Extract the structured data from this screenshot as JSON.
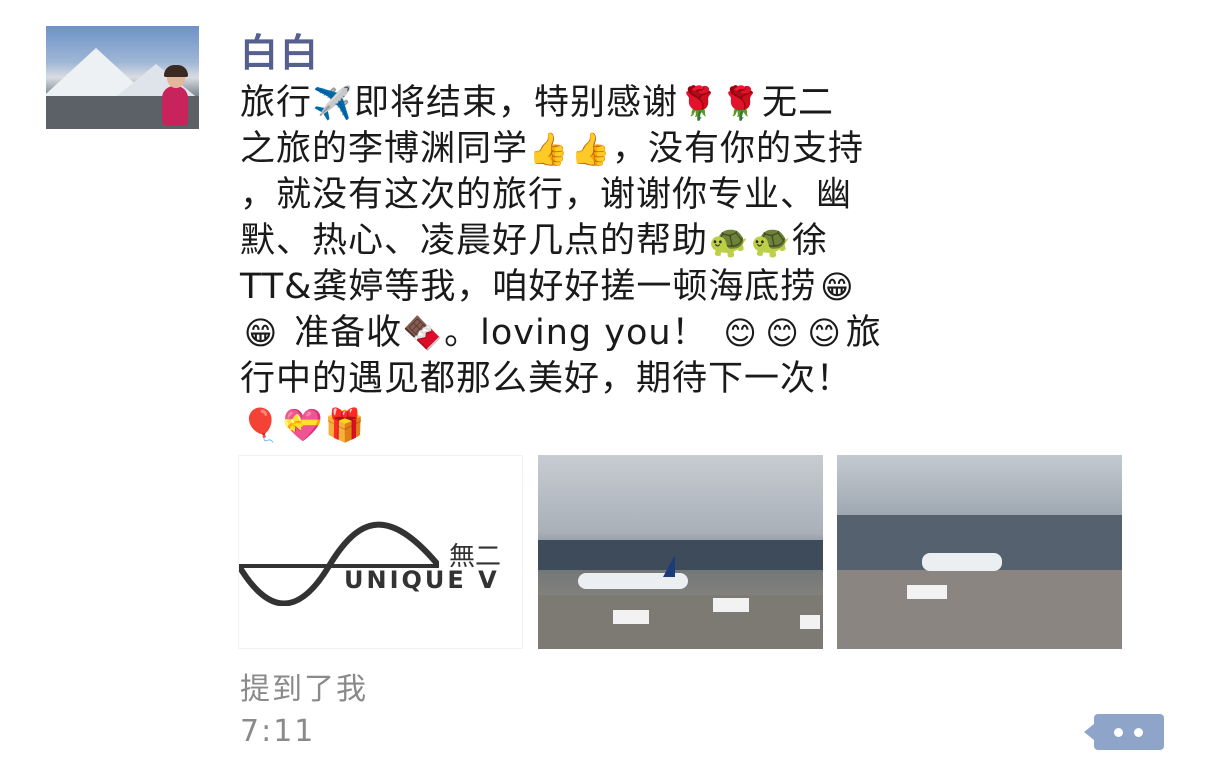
{
  "post": {
    "username": "白白",
    "lines": [
      [
        "旅行",
        "✈️",
        "即将结束，特别感谢",
        "🌹",
        "🌹",
        "无二"
      ],
      [
        "之旅的李博渊同学",
        "👍",
        "👍",
        "，没有你的支持"
      ],
      [
        "，就没有这次的旅行，谢谢你专业、幽"
      ],
      [
        "默、热心、凌晨好几点的帮助",
        "🐢",
        "🐢",
        "徐"
      ],
      [
        "TT&龚婷等我，咱好好搓一顿海底捞",
        "😁"
      ],
      [
        "😁",
        " 准备收",
        "🍫",
        "。loving you！ ",
        "😊",
        "😊",
        "😊",
        "旅"
      ],
      [
        "行中的遇见都那么美好，期待下一次！"
      ],
      [
        "🎈",
        "💝",
        "🎁"
      ]
    ],
    "images": {
      "logo_cn": "無二",
      "logo_en": "UNIQUE V"
    },
    "mentioned": "提到了我",
    "time": "7:11"
  },
  "icons": {
    "avatar": "profile-photo",
    "comment": "comment-dots-icon"
  },
  "colors": {
    "username": "#56608f",
    "meta_text": "#8a8a8a",
    "comment_button": "#8ea5c9"
  }
}
